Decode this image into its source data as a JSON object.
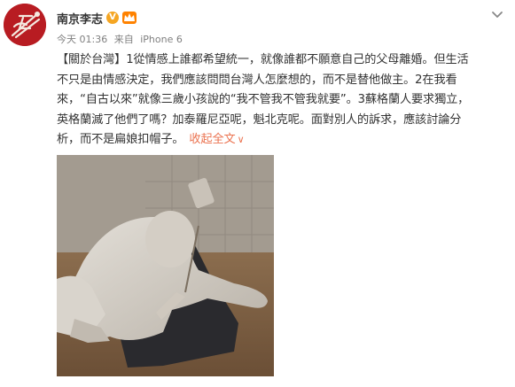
{
  "user": {
    "name": "南京李志",
    "verified_badge": "V",
    "avatar_icon": "chinese-knot-emblem",
    "member_icon": "crown-member-icon"
  },
  "meta": {
    "time": "今天 01:36",
    "source_prefix": "来自",
    "source": "iPhone 6"
  },
  "post": {
    "lines": [
      "【關於台灣】1從情感上誰都希望統一，就像誰都不願意自己的父母離婚。但生活",
      "不只是由情感決定，我們應該問問台灣人怎麼想的，而不是替他做主。2在我看",
      "來，“自古以來”就像三歲小孩說的“我不管我不管我就要”。3蘇格蘭人要求獨立，",
      "英格蘭滅了他們了嗎？加泰羅尼亞呢，魁北克呢。面對別人的訴求，應該討論分"
    ],
    "last_line": "析，而不是扁娘扣帽子。",
    "collapse_label": "收起全文",
    "collapse_arrow": "∨"
  },
  "colors": {
    "accent": "#eb7350",
    "text": "#333333",
    "meta": "#808080",
    "avatar_bg": "#b81c22",
    "verified": "#f5a623"
  }
}
